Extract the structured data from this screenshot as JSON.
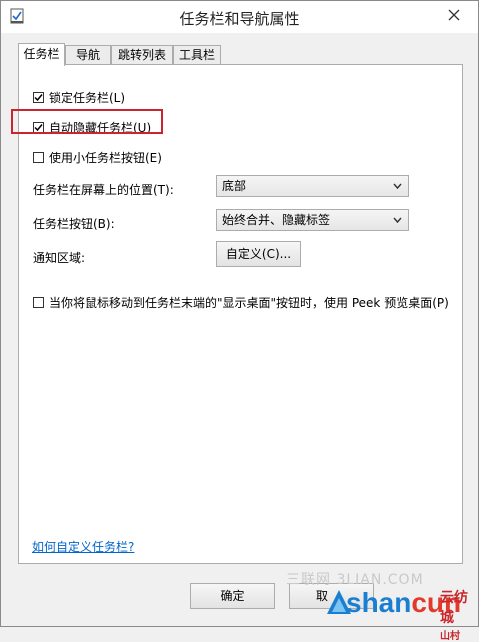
{
  "window": {
    "title": "任务栏和导航属性"
  },
  "tabs": [
    {
      "label": "任务栏",
      "active": true
    },
    {
      "label": "导航",
      "active": false
    },
    {
      "label": "跳转列表",
      "active": false
    },
    {
      "label": "工具栏",
      "active": false
    }
  ],
  "taskbar": {
    "lock_label": "锁定任务栏(L)",
    "lock_checked": true,
    "autohide_label": "自动隐藏任务栏(U)",
    "autohide_checked": true,
    "small_buttons_label": "使用小任务栏按钮(E)",
    "small_buttons_checked": false,
    "position_label": "任务栏在屏幕上的位置(T):",
    "position_value": "底部",
    "buttons_label": "任务栏按钮(B):",
    "buttons_value": "始终合并、隐藏标签",
    "notify_label": "通知区域:",
    "customize_button": "自定义(C)...",
    "peek_label": "当你将鼠标移动到任务栏末端的\"显示桌面\"按钮时，使用 Peek 预览桌面(P)",
    "peek_checked": false,
    "help_link": "如何自定义任务栏?"
  },
  "footer": {
    "ok_label": "确定",
    "cancel_label": "取"
  },
  "watermark": {
    "top_text": "三联网 3LIAN.COM",
    "brand_main": "shan",
    "brand_accent": "cun",
    "brand_cn": "云纺城",
    "brand_cn_small": "山村"
  },
  "colors": {
    "highlight": "#c8262b",
    "link": "#0066cc",
    "brand_blue": "#1a7fd0"
  }
}
